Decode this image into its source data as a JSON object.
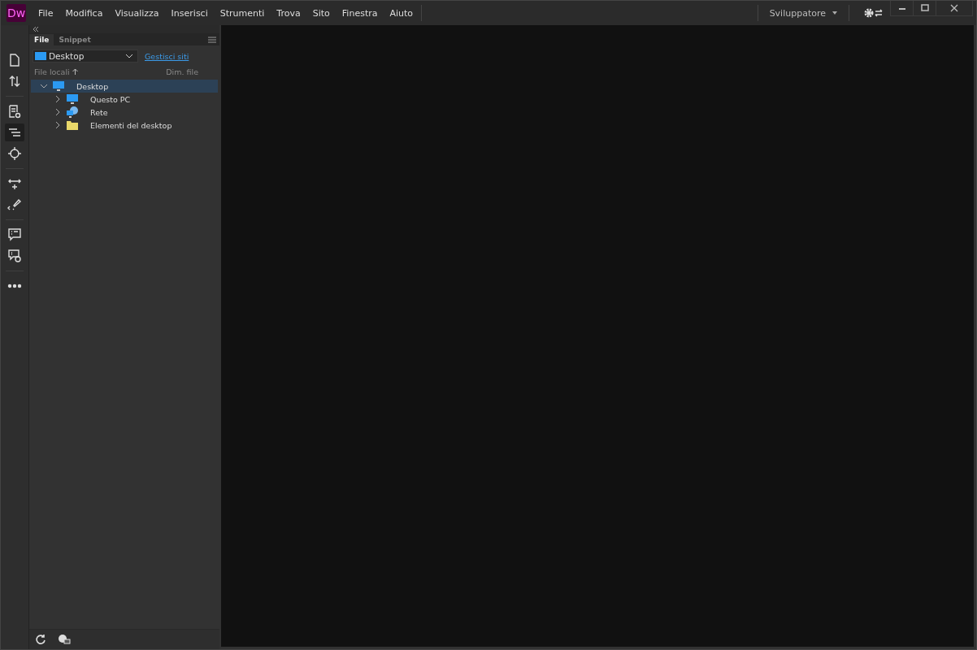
{
  "app": {
    "logo": "Dw"
  },
  "menu": [
    "File",
    "Modifica",
    "Visualizza",
    "Inserisci",
    "Strumenti",
    "Trova",
    "Sito",
    "Finestra",
    "Aiuto"
  ],
  "workspace": {
    "label": "Sviluppatore"
  },
  "toolbar": [
    {
      "kind": "file",
      "selected": false
    },
    {
      "kind": "transfer",
      "selected": false
    },
    {
      "kind": "preview",
      "selected": false
    },
    {
      "kind": "lines",
      "selected": true
    },
    {
      "kind": "target",
      "selected": false
    },
    {
      "kind": "width",
      "selected": false
    },
    {
      "kind": "brush",
      "selected": false
    },
    {
      "kind": "comment",
      "selected": false
    },
    {
      "kind": "comment-check",
      "selected": false
    },
    {
      "kind": "more",
      "selected": false
    }
  ],
  "panel": {
    "tabs": [
      {
        "label": "File",
        "selected": true
      },
      {
        "label": "Snippet",
        "selected": false
      }
    ],
    "site_select": {
      "value": "Desktop"
    },
    "manage_link": "Gestisci siti",
    "columns": [
      "File locali",
      "Dim. file"
    ],
    "tree": [
      {
        "name": "Desktop",
        "kind": "monitor",
        "expanded": true,
        "selected": true,
        "children": [
          {
            "name": "Questo PC",
            "kind": "monitor",
            "expanded": false,
            "selected": false
          },
          {
            "name": "Rete",
            "kind": "network",
            "expanded": false,
            "selected": false
          },
          {
            "name": "Elementi del desktop",
            "kind": "folder",
            "expanded": false,
            "selected": false
          }
        ]
      }
    ]
  }
}
